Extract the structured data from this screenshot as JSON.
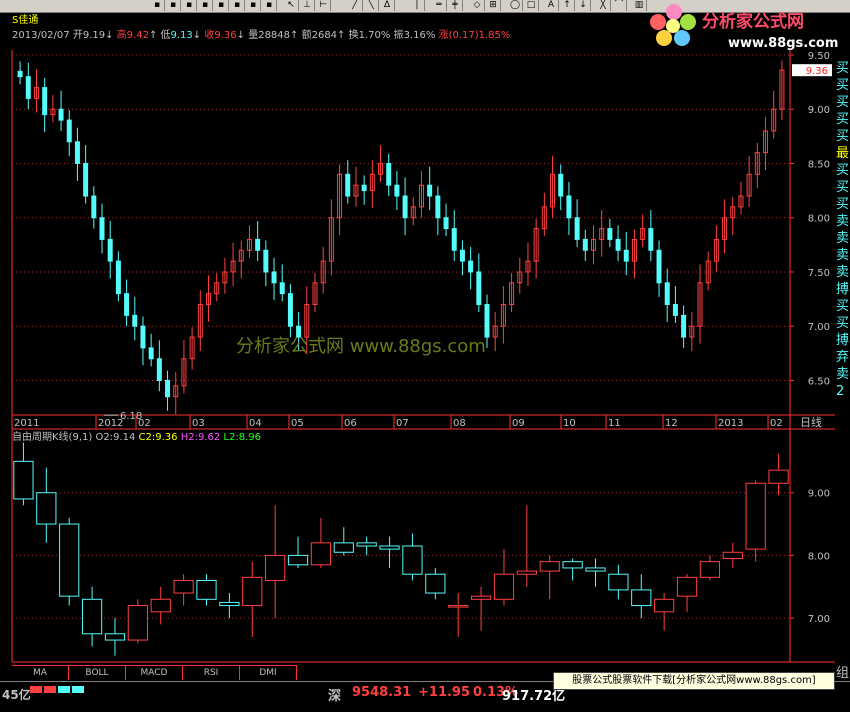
{
  "window": {
    "stock_name": "S佳通",
    "watermark": "分析家公式网 www.88gs.com",
    "logo_text": "分析家公式网",
    "logo_url": "www.88gs.com"
  },
  "quote": {
    "date": "2013/02/07",
    "open_label": "开",
    "open": "9.19",
    "open_arrow": "↓",
    "high_label": "高",
    "high": "9.42",
    "high_arrow": "↑",
    "low_label": "低",
    "low": "9.13",
    "low_arrow": "↓",
    "close_label": "收",
    "close": "9.36",
    "close_arrow": "↓",
    "volume_label": "量",
    "volume": "28848",
    "volume_arrow": "↑",
    "amount_label": "额",
    "amount": "2684",
    "amount_arrow": "↑",
    "turnover_label": "换",
    "turnover": "1.70%",
    "amplitude_label": "振",
    "amplitude": "3.16%",
    "change_label": "涨",
    "change": "(0.17)1.85%"
  },
  "indicator": {
    "name": "自由周期K线(9,1)",
    "o2_label": "O2:",
    "o2": "9.14",
    "c2_label": "C2:",
    "c2": "9.36",
    "h2_label": "H2:",
    "h2": "9.62",
    "l2_label": "L2:",
    "l2": "8.96"
  },
  "period": "日线",
  "side_text": [
    "买",
    "买",
    "买",
    "买",
    "买",
    "最",
    "买",
    "买",
    "买",
    "卖",
    "卖",
    "卖",
    "卖",
    "搏",
    "买",
    "买",
    "搏",
    "弃",
    "卖",
    "2"
  ],
  "tabs": [
    "MA",
    "BOLL",
    "MACD",
    "RSI",
    "DMI"
  ],
  "status": {
    "left_value": "45亿",
    "market": "深",
    "index": "9548.31",
    "change": "+11.95",
    "pct": "0.13%",
    "amount": "917.72亿",
    "promo": "股票公式股票软件下载[分析家公式网www.88gs.com]",
    "right_char": "组"
  },
  "colors": {
    "up": "#ff4040",
    "down": "#54fcfc",
    "text": "#c0c0c0",
    "axis": "#ff3030",
    "grid": "#a03030"
  },
  "chart_data": [
    {
      "type": "candlestick",
      "title": "S佳通",
      "ylim": [
        6.2,
        9.5
      ],
      "yticks": [
        9.5,
        9.0,
        8.5,
        8.0,
        7.5,
        7.0,
        6.5
      ],
      "last_price_label": "9.36",
      "min_label": "6.18",
      "xtick_labels": [
        "2011",
        "2012",
        "02",
        "03",
        "04",
        "05",
        "06",
        "07",
        "08",
        "09",
        "10",
        "11",
        "12",
        "2013",
        "02"
      ],
      "close_series": [
        9.3,
        9.1,
        9.2,
        8.95,
        9.0,
        8.9,
        8.7,
        8.5,
        8.2,
        8.0,
        7.8,
        7.6,
        7.3,
        7.1,
        7.0,
        6.8,
        6.7,
        6.5,
        6.35,
        6.45,
        6.7,
        6.9,
        7.2,
        7.3,
        7.4,
        7.5,
        7.6,
        7.7,
        7.8,
        7.7,
        7.5,
        7.4,
        7.3,
        7.0,
        6.9,
        7.2,
        7.4,
        7.6,
        8.0,
        8.4,
        8.2,
        8.3,
        8.25,
        8.4,
        8.5,
        8.3,
        8.2,
        8.0,
        8.1,
        8.3,
        8.2,
        8.0,
        7.9,
        7.7,
        7.6,
        7.5,
        7.2,
        6.9,
        7.0,
        7.2,
        7.4,
        7.5,
        7.6,
        7.9,
        8.1,
        8.4,
        8.2,
        8.0,
        7.8,
        7.7,
        7.8,
        7.9,
        7.8,
        7.7,
        7.6,
        7.8,
        7.9,
        7.7,
        7.4,
        7.2,
        7.1,
        6.9,
        7.0,
        7.4,
        7.6,
        7.8,
        8.0,
        8.1,
        8.2,
        8.4,
        8.6,
        8.8,
        9.0,
        9.36
      ]
    },
    {
      "type": "candlestick",
      "title": "自由周期K线(9,1)",
      "ylim": [
        6.3,
        10.0
      ],
      "yticks": [
        9.0,
        8.0,
        7.0
      ],
      "candles": [
        {
          "o": 9.5,
          "h": 9.8,
          "l": 8.8,
          "c": 8.9
        },
        {
          "o": 9.0,
          "h": 9.4,
          "l": 8.2,
          "c": 8.5
        },
        {
          "o": 8.5,
          "h": 8.6,
          "l": 7.2,
          "c": 7.35
        },
        {
          "o": 7.3,
          "h": 7.5,
          "l": 6.55,
          "c": 6.75
        },
        {
          "o": 6.75,
          "h": 7.0,
          "l": 6.4,
          "c": 6.65
        },
        {
          "o": 6.65,
          "h": 7.3,
          "l": 6.6,
          "c": 7.2
        },
        {
          "o": 7.1,
          "h": 7.5,
          "l": 6.9,
          "c": 7.3
        },
        {
          "o": 7.4,
          "h": 7.7,
          "l": 7.2,
          "c": 7.6
        },
        {
          "o": 7.6,
          "h": 7.7,
          "l": 7.2,
          "c": 7.3
        },
        {
          "o": 7.25,
          "h": 7.4,
          "l": 7.0,
          "c": 7.2
        },
        {
          "o": 7.2,
          "h": 7.9,
          "l": 6.7,
          "c": 7.65
        },
        {
          "o": 7.6,
          "h": 8.8,
          "l": 7.0,
          "c": 8.0
        },
        {
          "o": 8.0,
          "h": 8.3,
          "l": 7.8,
          "c": 7.85
        },
        {
          "o": 7.85,
          "h": 8.6,
          "l": 7.8,
          "c": 8.2
        },
        {
          "o": 8.2,
          "h": 8.45,
          "l": 8.0,
          "c": 8.05
        },
        {
          "o": 8.2,
          "h": 8.3,
          "l": 8.0,
          "c": 8.15
        },
        {
          "o": 8.15,
          "h": 8.3,
          "l": 7.8,
          "c": 8.1
        },
        {
          "o": 8.15,
          "h": 8.35,
          "l": 7.6,
          "c": 7.7
        },
        {
          "o": 7.7,
          "h": 7.8,
          "l": 7.3,
          "c": 7.4
        },
        {
          "o": 7.2,
          "h": 7.4,
          "l": 6.7,
          "c": 7.2
        },
        {
          "o": 7.3,
          "h": 7.5,
          "l": 6.8,
          "c": 7.35
        },
        {
          "o": 7.3,
          "h": 8.1,
          "l": 7.2,
          "c": 7.7
        },
        {
          "o": 7.7,
          "h": 8.8,
          "l": 7.5,
          "c": 7.75
        },
        {
          "o": 7.75,
          "h": 8.0,
          "l": 7.3,
          "c": 7.9
        },
        {
          "o": 7.9,
          "h": 7.95,
          "l": 7.6,
          "c": 7.8
        },
        {
          "o": 7.8,
          "h": 7.95,
          "l": 7.5,
          "c": 7.75
        },
        {
          "o": 7.7,
          "h": 7.85,
          "l": 7.3,
          "c": 7.45
        },
        {
          "o": 7.45,
          "h": 7.7,
          "l": 7.0,
          "c": 7.2
        },
        {
          "o": 7.1,
          "h": 7.4,
          "l": 6.8,
          "c": 7.3
        },
        {
          "o": 7.35,
          "h": 7.7,
          "l": 7.1,
          "c": 7.65
        },
        {
          "o": 7.65,
          "h": 8.0,
          "l": 7.6,
          "c": 7.9
        },
        {
          "o": 7.95,
          "h": 8.2,
          "l": 7.8,
          "c": 8.05
        },
        {
          "o": 8.1,
          "h": 9.2,
          "l": 7.9,
          "c": 9.15
        },
        {
          "o": 9.15,
          "h": 9.62,
          "l": 8.96,
          "c": 9.36
        }
      ]
    }
  ]
}
